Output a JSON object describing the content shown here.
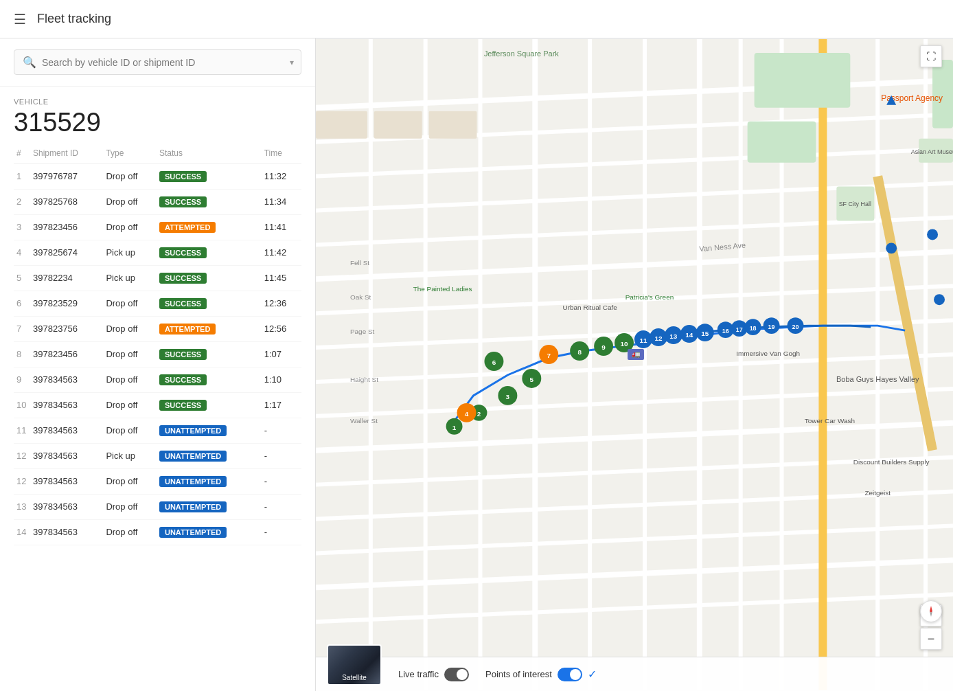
{
  "header": {
    "menu_icon": "☰",
    "title": "Fleet tracking"
  },
  "search": {
    "placeholder": "Search by vehicle ID or shipment ID"
  },
  "vehicle": {
    "label": "VEHICLE",
    "id": "315529"
  },
  "table": {
    "columns": [
      "#",
      "Shipment ID",
      "Type",
      "Status",
      "Time"
    ],
    "rows": [
      {
        "num": 1,
        "shipment_id": "397976787",
        "type": "Drop off",
        "status": "SUCCESS",
        "time": "11:32"
      },
      {
        "num": 2,
        "shipment_id": "397825768",
        "type": "Drop off",
        "status": "SUCCESS",
        "time": "11:34"
      },
      {
        "num": 3,
        "shipment_id": "397823456",
        "type": "Drop off",
        "status": "ATTEMPTED",
        "time": "11:41"
      },
      {
        "num": 4,
        "shipment_id": "397825674",
        "type": "Pick up",
        "status": "SUCCESS",
        "time": "11:42"
      },
      {
        "num": 5,
        "shipment_id": "39782234",
        "type": "Pick up",
        "status": "SUCCESS",
        "time": "11:45"
      },
      {
        "num": 6,
        "shipment_id": "397823529",
        "type": "Drop off",
        "status": "SUCCESS",
        "time": "12:36"
      },
      {
        "num": 7,
        "shipment_id": "397823756",
        "type": "Drop off",
        "status": "ATTEMPTED",
        "time": "12:56"
      },
      {
        "num": 8,
        "shipment_id": "397823456",
        "type": "Drop off",
        "status": "SUCCESS",
        "time": "1:07"
      },
      {
        "num": 9,
        "shipment_id": "397834563",
        "type": "Drop off",
        "status": "SUCCESS",
        "time": "1:10"
      },
      {
        "num": 10,
        "shipment_id": "397834563",
        "type": "Drop off",
        "status": "SUCCESS",
        "time": "1:17"
      },
      {
        "num": 11,
        "shipment_id": "397834563",
        "type": "Drop off",
        "status": "UNATTEMPTED",
        "time": "-"
      },
      {
        "num": 12,
        "shipment_id": "397834563",
        "type": "Pick up",
        "status": "UNATTEMPTED",
        "time": "-"
      },
      {
        "num": 12,
        "shipment_id": "397834563",
        "type": "Drop off",
        "status": "UNATTEMPTED",
        "time": "-"
      },
      {
        "num": 13,
        "shipment_id": "397834563",
        "type": "Drop off",
        "status": "UNATTEMPTED",
        "time": "-"
      },
      {
        "num": 14,
        "shipment_id": "397834563",
        "type": "Drop off",
        "status": "UNATTEMPTED",
        "time": "-"
      }
    ]
  },
  "map": {
    "live_traffic_label": "Live traffic",
    "poi_label": "Points of interest",
    "satellite_label": "Satellite",
    "zoom_in": "+",
    "zoom_out": "−",
    "passport_agency": "Passport Agency"
  }
}
